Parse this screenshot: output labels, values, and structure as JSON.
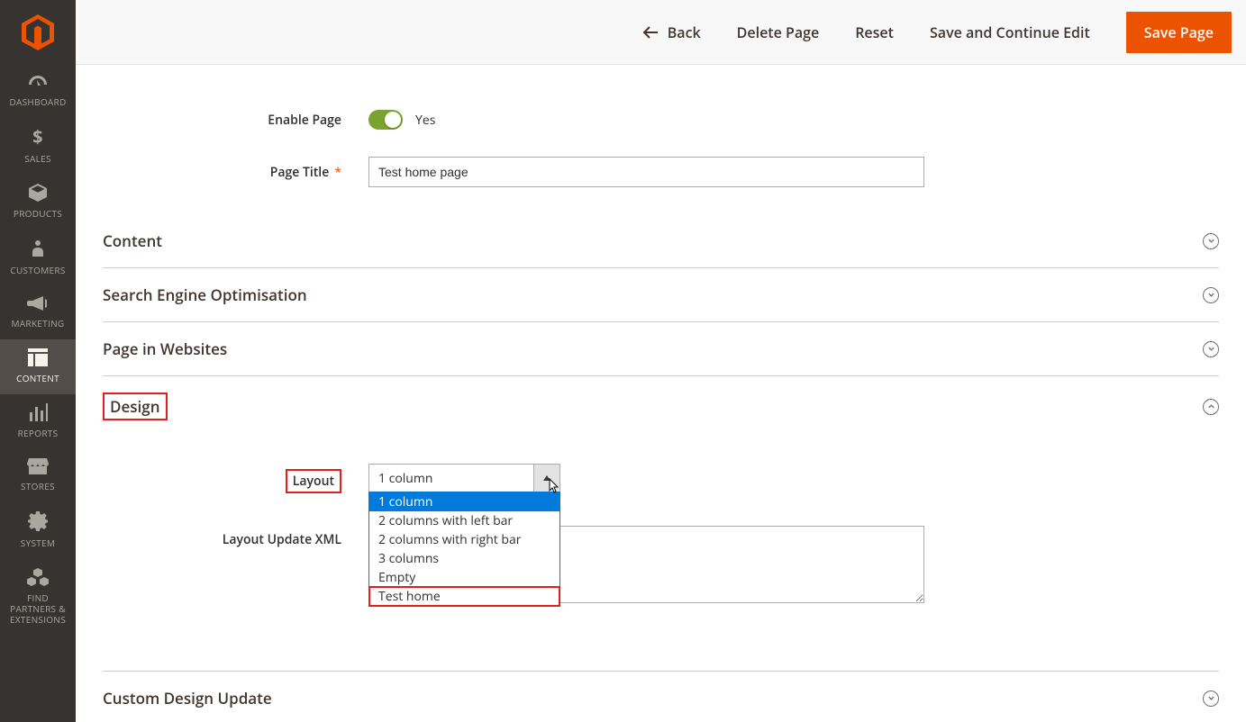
{
  "sidebar": {
    "items": [
      {
        "label": "DASHBOARD",
        "icon": "dashboard"
      },
      {
        "label": "SALES",
        "icon": "dollar"
      },
      {
        "label": "PRODUCTS",
        "icon": "box"
      },
      {
        "label": "CUSTOMERS",
        "icon": "person"
      },
      {
        "label": "MARKETING",
        "icon": "megaphone"
      },
      {
        "label": "CONTENT",
        "icon": "layout",
        "active": true
      },
      {
        "label": "REPORTS",
        "icon": "bars"
      },
      {
        "label": "STORES",
        "icon": "storefront"
      },
      {
        "label": "SYSTEM",
        "icon": "gear"
      },
      {
        "label": "FIND PARTNERS & EXTENSIONS",
        "icon": "cubes"
      }
    ]
  },
  "topActions": {
    "back": "Back",
    "deletePage": "Delete Page",
    "reset": "Reset",
    "saveContinue": "Save and Continue Edit",
    "savePage": "Save Page"
  },
  "form": {
    "enablePage": {
      "label": "Enable Page",
      "valueText": "Yes",
      "on": true
    },
    "pageTitle": {
      "label": "Page Title",
      "value": "Test home page"
    },
    "layoutUpdateXml": {
      "label": "Layout Update XML",
      "value": ""
    }
  },
  "accordions": {
    "content": {
      "title": "Content",
      "expanded": false
    },
    "seo": {
      "title": "Search Engine Optimisation",
      "expanded": false
    },
    "pageInWebsites": {
      "title": "Page in Websites",
      "expanded": false
    },
    "design": {
      "title": "Design",
      "expanded": true
    },
    "customDesignUpdate": {
      "title": "Custom Design Update",
      "expanded": false
    }
  },
  "design": {
    "layoutLabel": "Layout",
    "layoutSelected": "1 column",
    "layoutOptions": [
      "1 column",
      "2 columns with left bar",
      "2 columns with right bar",
      "3 columns",
      "Empty",
      "Test home"
    ],
    "highlightedOption": "Test home"
  },
  "colors": {
    "accent": "#eb5202",
    "highlight": "#e41d1d",
    "link": "#007bdb",
    "sidebar": "#373330",
    "toggleOn": "#79a22e"
  }
}
